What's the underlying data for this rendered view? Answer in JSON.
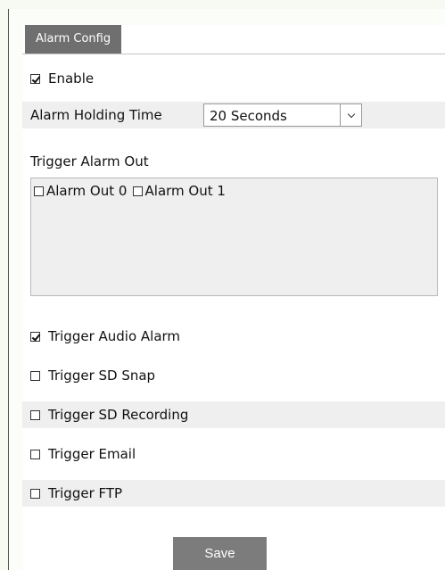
{
  "tab": {
    "label": "Alarm Config"
  },
  "enable": {
    "label": "Enable",
    "checked": true
  },
  "holding_time": {
    "label": "Alarm Holding Time",
    "value": "20 Seconds"
  },
  "trigger_alarm_out": {
    "label": "Trigger Alarm Out",
    "outputs": [
      {
        "label": "Alarm Out 0",
        "checked": false
      },
      {
        "label": "Alarm Out 1",
        "checked": false
      }
    ]
  },
  "triggers": [
    {
      "label": "Trigger Audio Alarm",
      "checked": true
    },
    {
      "label": "Trigger SD Snap",
      "checked": false
    },
    {
      "label": "Trigger SD Recording",
      "checked": false
    },
    {
      "label": "Trigger Email",
      "checked": false
    },
    {
      "label": "Trigger FTP",
      "checked": false
    }
  ],
  "save_label": "Save"
}
